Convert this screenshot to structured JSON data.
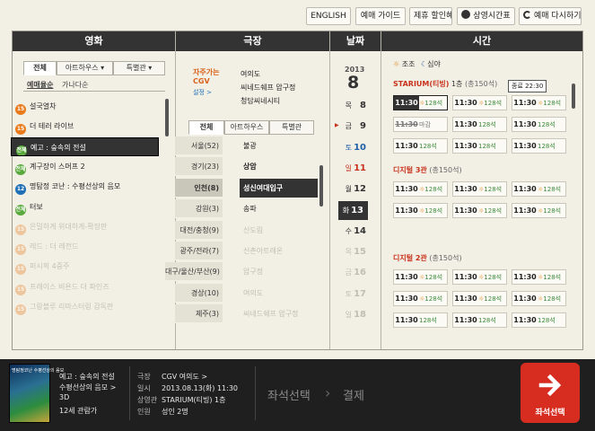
{
  "top_buttons": [
    "ENGLISH",
    "예매 가이드",
    "제휴 할인혜택",
    "상영시간표",
    "예매 다시하기"
  ],
  "columns": {
    "movie": "영화",
    "theater": "극장",
    "date": "날짜",
    "time": "시간"
  },
  "movie_tabs": [
    "전체",
    "아트하우스 ▾",
    "특별관 ▾"
  ],
  "sort_options": [
    "예매율순",
    "가나다순"
  ],
  "movies": [
    {
      "age": "15",
      "title": "설국열차",
      "age_color": "#e97b1d"
    },
    {
      "age": "15",
      "title": "더 테러 라이브",
      "age_color": "#e97b1d"
    },
    {
      "age": "전체",
      "title": "예고 : 숲속의 전설",
      "age_color": "#59a93c"
    },
    {
      "age": "전체",
      "title": "계구장이 스머프 2",
      "age_color": "#59a93c"
    },
    {
      "age": "12",
      "title": "명탐정 코난 : 수평선상의 음모",
      "age_color": "#1e6fb5"
    },
    {
      "age": "전체",
      "title": "터보",
      "age_color": "#59a93c"
    },
    {
      "age": "15",
      "title": "은밀하게 위대하게-확장판",
      "age_color": "#e97b1d"
    },
    {
      "age": "15",
      "title": "레드 : 더 레전드",
      "age_color": "#e97b1d"
    },
    {
      "age": "15",
      "title": "퍼시픽 4중주",
      "age_color": "#e97b1d"
    },
    {
      "age": "15",
      "title": "프레이스 비욘드 더 파인즈",
      "age_color": "#e97b1d"
    },
    {
      "age": "15",
      "title": "그랑블루 리마스터링 감독판",
      "age_color": "#e97b1d"
    }
  ],
  "favorites": {
    "label": "자주가는 CGV",
    "setting": "설정 >",
    "items": [
      "여의도",
      "씨네드쉐프 압구정",
      "청담씨네시티"
    ]
  },
  "theater_tabs": [
    "전체",
    "아트하우스",
    "특별관"
  ],
  "regions": [
    "서울(52)",
    "경기(23)",
    "인천(8)",
    "강원(3)",
    "대전/충청(9)",
    "광주/전라(7)",
    "대구/울산/부산(9)",
    "경상(10)",
    "제주(3)"
  ],
  "theaters": [
    "불광",
    "상암",
    "성신여대입구",
    "송파",
    "신도림",
    "신촌아트레온",
    "압구정",
    "여의도",
    "씨네드쉐프 압구정"
  ],
  "date_header": {
    "year": "2013",
    "month": "8"
  },
  "dates": [
    {
      "dow": "목",
      "day": "8"
    },
    {
      "dow": "금",
      "day": "9"
    },
    {
      "dow": "토",
      "day": "10"
    },
    {
      "dow": "일",
      "day": "11"
    },
    {
      "dow": "월",
      "day": "12"
    },
    {
      "dow": "화",
      "day": "13"
    },
    {
      "dow": "수",
      "day": "14"
    },
    {
      "dow": "목",
      "day": "15"
    },
    {
      "dow": "금",
      "day": "16"
    },
    {
      "dow": "토",
      "day": "17"
    },
    {
      "dow": "일",
      "day": "18"
    }
  ],
  "time_legend": {
    "morning": "조조",
    "night": "심야"
  },
  "halls": [
    {
      "name": "STARIUM(티빙)",
      "floor": " 1층",
      "cap": "(총150석)"
    },
    {
      "name": "디지털 3관",
      "floor": "",
      "cap": "(총150석)"
    },
    {
      "name": "디지털 2관",
      "floor": "",
      "cap": "(총150석)"
    }
  ],
  "slot_time": "11:30",
  "seat_text": "128석",
  "past_text": "마감",
  "tooltip": "종료 22:30",
  "summary": {
    "poster_text": "명탐정코난 수평선상의 음모",
    "movie_title": "예고 : 숲속의 전설",
    "movie_sub": "수평선상의 음모 >",
    "format": "3D",
    "rating": "12세 관람가",
    "labels": {
      "theater": "극장",
      "date": "일시",
      "screen": "상영관",
      "people": "인원"
    },
    "theater": "CGV 여의도 >",
    "date": "2013.08.13(화) 11:30",
    "screen": "STARIUM(티빙) 1층",
    "people": "성인 2명"
  },
  "steps": {
    "seat": "좌석선택",
    "pay": "결제"
  },
  "go_button": "좌석선택",
  "colors": {
    "accent_red": "#d62d20",
    "header_dark": "#333333",
    "seat_green": "#3d8a3a"
  }
}
